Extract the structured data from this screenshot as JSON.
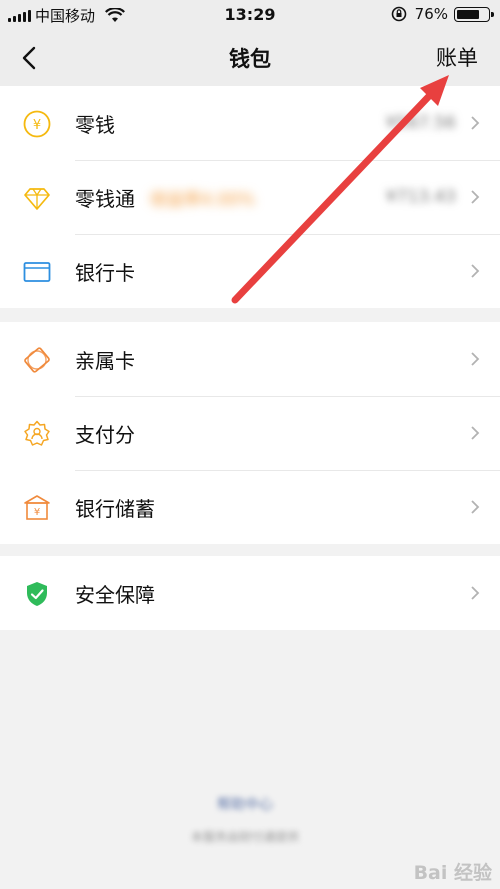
{
  "status_bar": {
    "carrier": "中国移动",
    "time": "13:29",
    "battery": "76%",
    "battery_level": 0.76
  },
  "nav": {
    "title": "钱包",
    "action": "账单"
  },
  "groups": [
    {
      "items": [
        {
          "label": "零钱",
          "icon": "coin-icon",
          "value": "¥567.56"
        },
        {
          "label": "零钱通",
          "icon": "diamond-icon",
          "tag": "收益率4.00%",
          "value": "¥713.43"
        },
        {
          "label": "银行卡",
          "icon": "bank-card-icon"
        }
      ]
    },
    {
      "items": [
        {
          "label": "亲属卡",
          "icon": "family-card-icon"
        },
        {
          "label": "支付分",
          "icon": "pay-score-icon"
        },
        {
          "label": "银行储蓄",
          "icon": "bank-savings-icon"
        }
      ]
    },
    {
      "items": [
        {
          "label": "安全保障",
          "icon": "security-shield-icon"
        }
      ]
    }
  ],
  "footer": {
    "help_link": "帮助中心",
    "note": "本服务由财付通提供"
  },
  "watermark": "Bai 经验",
  "colors": {
    "coin": "#f5b90f",
    "diamond": "#f5b90f",
    "bank_card": "#2d8fe0",
    "family_card": "#f08a3c",
    "pay_score": "#f5a623",
    "savings": "#f08a3c",
    "shield": "#2fbb5a",
    "arrow": "#e8403f"
  }
}
